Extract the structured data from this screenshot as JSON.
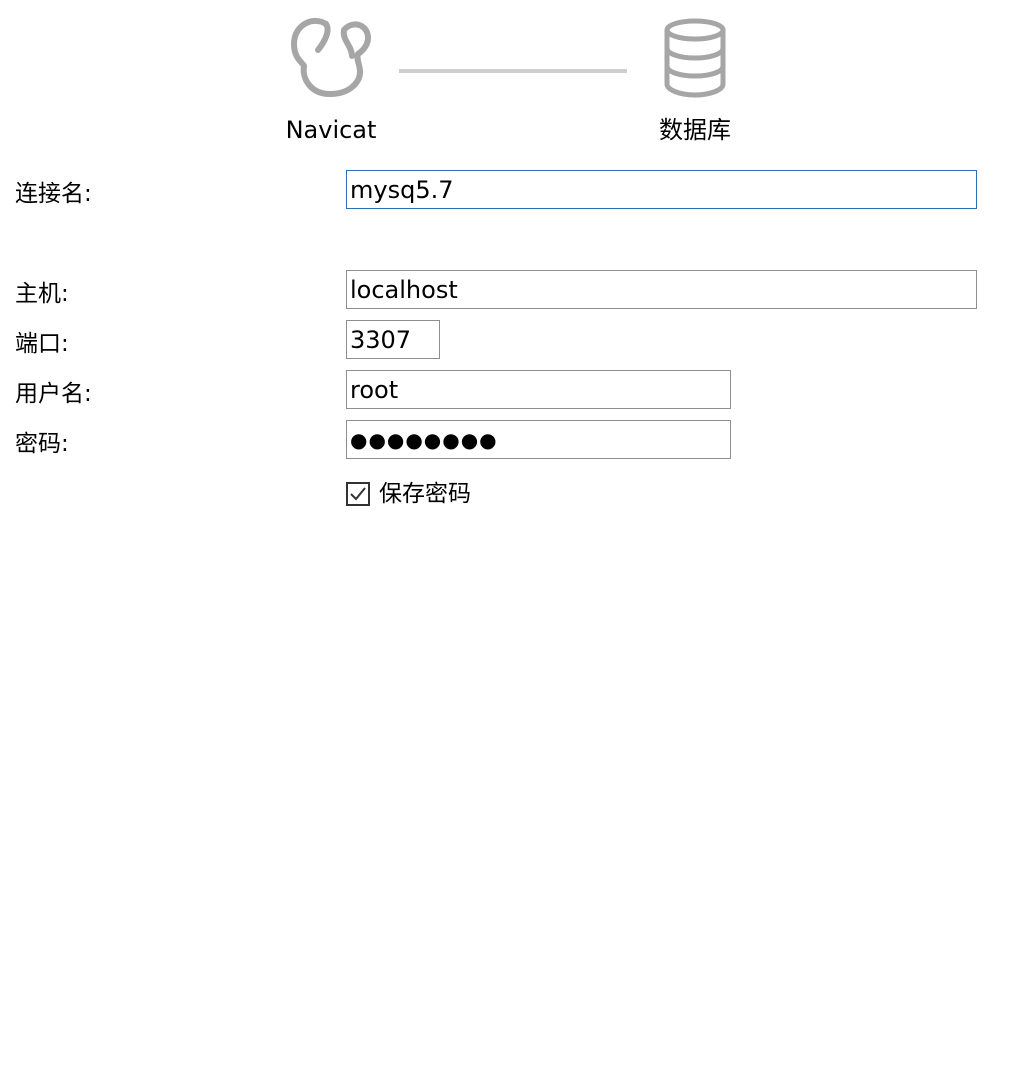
{
  "wizard": {
    "steps": [
      {
        "label": "Navicat",
        "icon": "navicat-logo-icon"
      },
      {
        "label": "数据库",
        "icon": "database-icon"
      }
    ]
  },
  "form": {
    "connection_name": {
      "label": "连接名:",
      "value": "mysq5.7"
    },
    "host": {
      "label": "主机:",
      "value": "localhost"
    },
    "port": {
      "label": "端口:",
      "value": "3307"
    },
    "username": {
      "label": "用户名:",
      "value": "root"
    },
    "password": {
      "label": "密码:",
      "value": "●●●●●●●●"
    },
    "save_password": {
      "label": "保存密码",
      "checked": true
    }
  },
  "colors": {
    "icon_gray": "#a6a6a6",
    "connector": "#cfcfcf",
    "focus_border": "#2b6fb6",
    "input_border": "#8e8e8e"
  }
}
